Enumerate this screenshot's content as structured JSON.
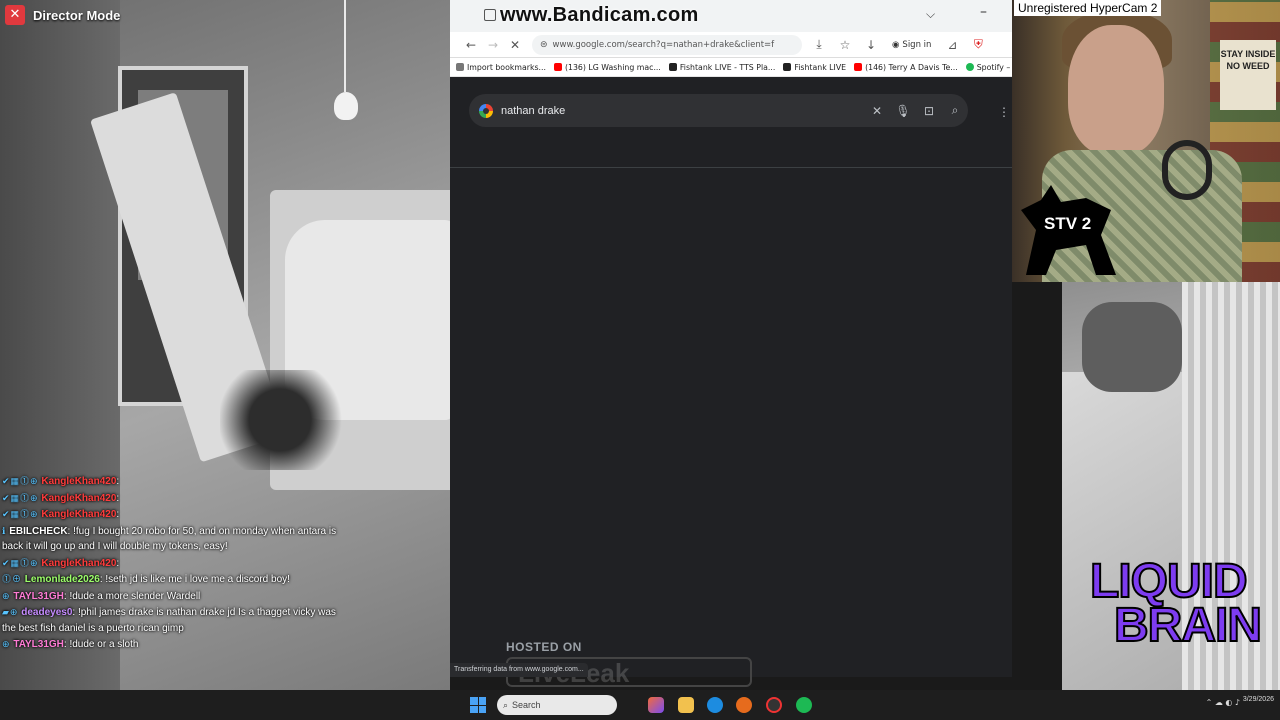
{
  "director": {
    "close_label": "✕",
    "title": "Director Mode"
  },
  "chat": [
    {
      "user": "KangleKhan420",
      "user_color": "#ff3b3b",
      "badges": "✔▦⓵⊕",
      "message": ""
    },
    {
      "user": "KangleKhan420",
      "user_color": "#ff3b3b",
      "badges": "✔▦⓵⊕",
      "message": ""
    },
    {
      "user": "KangleKhan420",
      "user_color": "#ff3b3b",
      "badges": "✔▦⓵⊕",
      "message": ""
    },
    {
      "user": "EBILCHECK",
      "user_color": "#ffffff",
      "badges": "ℹ",
      "message": "!fug I bought 20 robo for 50, and on monday when antara is back it will go up and I will double my tokens, easy!"
    },
    {
      "user": "KangleKhan420",
      "user_color": "#ff3b3b",
      "badges": "✔▦⓵⊕",
      "message": ""
    },
    {
      "user": "Lemonlade2026",
      "user_color": "#9cff6a",
      "badges": "⓵⊕",
      "message": "!seth jd is like me i love me a discord boy!"
    },
    {
      "user": "TAYL31GH",
      "user_color": "#ff7bd5",
      "badges": "⊕",
      "message": "!dude a more slender Wardell"
    },
    {
      "user": "deadeyes0",
      "user_color": "#c58bff",
      "badges": "▰⊕",
      "message": "!phil james drake is nathan drake jd Is a thagget vicky was the best fish daniel is a puerto rican gimp"
    },
    {
      "user": "TAYL31GH",
      "user_color": "#ff7bd5",
      "badges": "⊕",
      "message": "!dude or a sloth"
    }
  ],
  "browser": {
    "watermark": "www.Bandicam.com",
    "tab_dropdown_icon": "⌵",
    "minimize_icon": "–",
    "nav": {
      "back": "←",
      "forward": "→",
      "reload": "✕",
      "lock": "⊜",
      "url": "www.google.com/search?q=nathan+drake&client=f",
      "signin_label": "Sign in"
    },
    "bookmarks": [
      {
        "label": "Import bookmarks...",
        "color": "#777777"
      },
      {
        "label": "(136) LG Washing mac...",
        "color": "#ff0000"
      },
      {
        "label": "Fishtank LIVE - TTS Pla...",
        "color": "#222222"
      },
      {
        "label": "Fishtank LIVE",
        "color": "#222222"
      },
      {
        "label": "(146) Terry A Davis Te...",
        "color": "#ff0000"
      },
      {
        "label": "Spotify – Web Pla",
        "color": "#1db954"
      }
    ],
    "search": {
      "query": "nathan drake",
      "clear_icon": "✕",
      "mic_icon": "🎙",
      "lens_icon": "⊡",
      "search_icon": "⌕",
      "apps_icon": "⋮⋮⋮"
    },
    "hosted_on": "HOSTED ON",
    "liveleak": "LiveLeak",
    "status": "Transferring data from www.google.com..."
  },
  "webcam": {
    "hypercam": "Unregistered HyperCam 2",
    "sign": "STAY INSIDE NO WEED",
    "stv": "STV 2"
  },
  "logo": {
    "line1": "LIQUID",
    "line2": "BRAIN"
  },
  "taskbar": {
    "search_label": "Search",
    "date": "3/29/2026"
  }
}
